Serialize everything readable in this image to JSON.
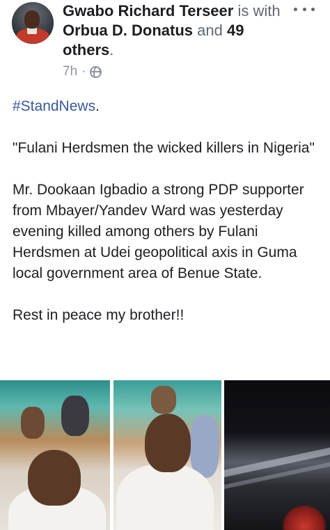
{
  "post": {
    "author": "Gwabo Richard Terseer",
    "with_word": "is with",
    "tagged": "Orbua D. Donatus",
    "and_word": "and",
    "others": "49 others",
    "time": "7h",
    "privacy_icon": "globe-icon",
    "hashtag": "#StandNews",
    "hashtag_suffix": ".",
    "quote": "\"Fulani Herdsmen the wicked killers in Nigeria\"",
    "paragraph": "Mr. Dookaan Igbadio a strong PDP supporter from Mbayer/Yandev Ward was yesterday evening killed among others by Fulani Herdsmen at Udei geopolitical axis in Guma local government area of Benue State.",
    "closing": "Rest in peace my brother!!"
  },
  "colors": {
    "text": "#1c1e21",
    "secondary": "#606770",
    "meta": "#8d949e",
    "link": "#385898"
  }
}
